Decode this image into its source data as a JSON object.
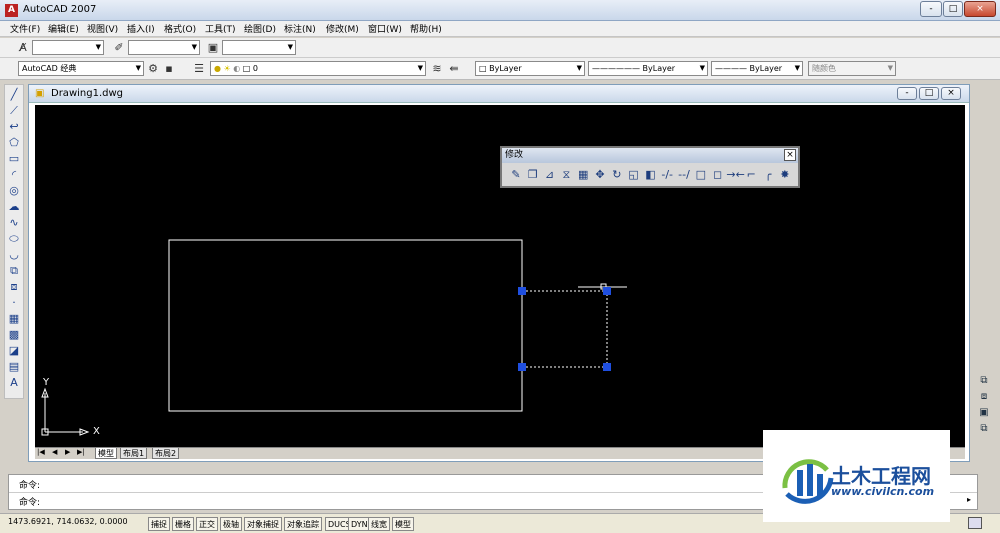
{
  "app": {
    "title": "AutoCAD 2007",
    "icon": "autocad-app-icon",
    "window_buttons": [
      "-",
      "□",
      "×"
    ]
  },
  "menu": [
    "文件(F)",
    "编辑(E)",
    "视图(V)",
    "插入(I)",
    "格式(O)",
    "工具(T)",
    "绘图(D)",
    "标注(N)",
    "修改(M)",
    "窗口(W)",
    "帮助(H)"
  ],
  "toolbar1": {
    "combo1": "",
    "combo2": "",
    "combo3": ""
  },
  "toolbar2": {
    "workspace": "AutoCAD 经典",
    "layer": "0",
    "color": "ByLayer",
    "linetype": "ByLayer",
    "lineweight": "ByLayer",
    "plotstyle": "随颜色"
  },
  "document": {
    "title": "Drawing1.dwg",
    "window_buttons": [
      "-",
      "□",
      "×"
    ]
  },
  "left_tools": [
    "line-icon",
    "construction-line-icon",
    "polyline-icon",
    "polygon-icon",
    "rectangle-icon",
    "arc-icon",
    "circle-icon",
    "revision-cloud-icon",
    "spline-icon",
    "ellipse-icon",
    "ellipse-arc-icon",
    "insert-block-icon",
    "make-block-icon",
    "point-icon",
    "hatch-icon",
    "gradient-icon",
    "region-icon",
    "table-icon",
    "multiline-text-icon"
  ],
  "left_tool_glyphs": [
    "╱",
    "⟋",
    "↩",
    "⬠",
    "▭",
    "◜",
    "◎",
    "☁",
    "∿",
    "⬭",
    "◡",
    "⧉",
    "⧈",
    "·",
    "▦",
    "▩",
    "◪",
    "▤",
    "A"
  ],
  "modify_toolbar": {
    "title": "修改",
    "close": "×",
    "tools": [
      "erase-icon",
      "copy-icon",
      "mirror-icon",
      "offset-icon",
      "array-icon",
      "move-icon",
      "rotate-icon",
      "scale-icon",
      "stretch-icon",
      "trim-icon",
      "extend-icon",
      "break-at-point-icon",
      "break-icon",
      "join-icon",
      "chamfer-icon",
      "fillet-icon",
      "explode-icon"
    ],
    "glyphs": [
      "✎",
      "❐",
      "⊿",
      "⧖",
      "▦",
      "✥",
      "↻",
      "◱",
      "◧",
      "-/-",
      "--/",
      "□",
      "◻",
      "→←",
      "⌐",
      "╭",
      "✸"
    ]
  },
  "canvas": {
    "ucs_x": "X",
    "ucs_y": "Y",
    "line_color": "#ffffff",
    "grip_color": "#1f4fe0"
  },
  "layout_tabs": {
    "nav": [
      "|◀",
      "◀",
      "▶",
      "▶|"
    ],
    "tabs": [
      "模型",
      "布局1",
      "布局2"
    ],
    "active": "模型"
  },
  "command": {
    "line1": "命令:",
    "line2": "命令:"
  },
  "status": {
    "coords": "1473.6921, 714.0632, 0.0000",
    "buttons": [
      "捕捉",
      "栅格",
      "正交",
      "极轴",
      "对象捕捉",
      "对象追踪",
      "DUCS",
      "DYN",
      "线宽",
      "模型"
    ]
  },
  "right_tools": [
    "zoom-window-icon",
    "zoom-previous-icon",
    "viewport-icon",
    "layer-state-icon"
  ],
  "watermark": {
    "brand": "土木工程网",
    "url": "www.civilcn.com"
  }
}
